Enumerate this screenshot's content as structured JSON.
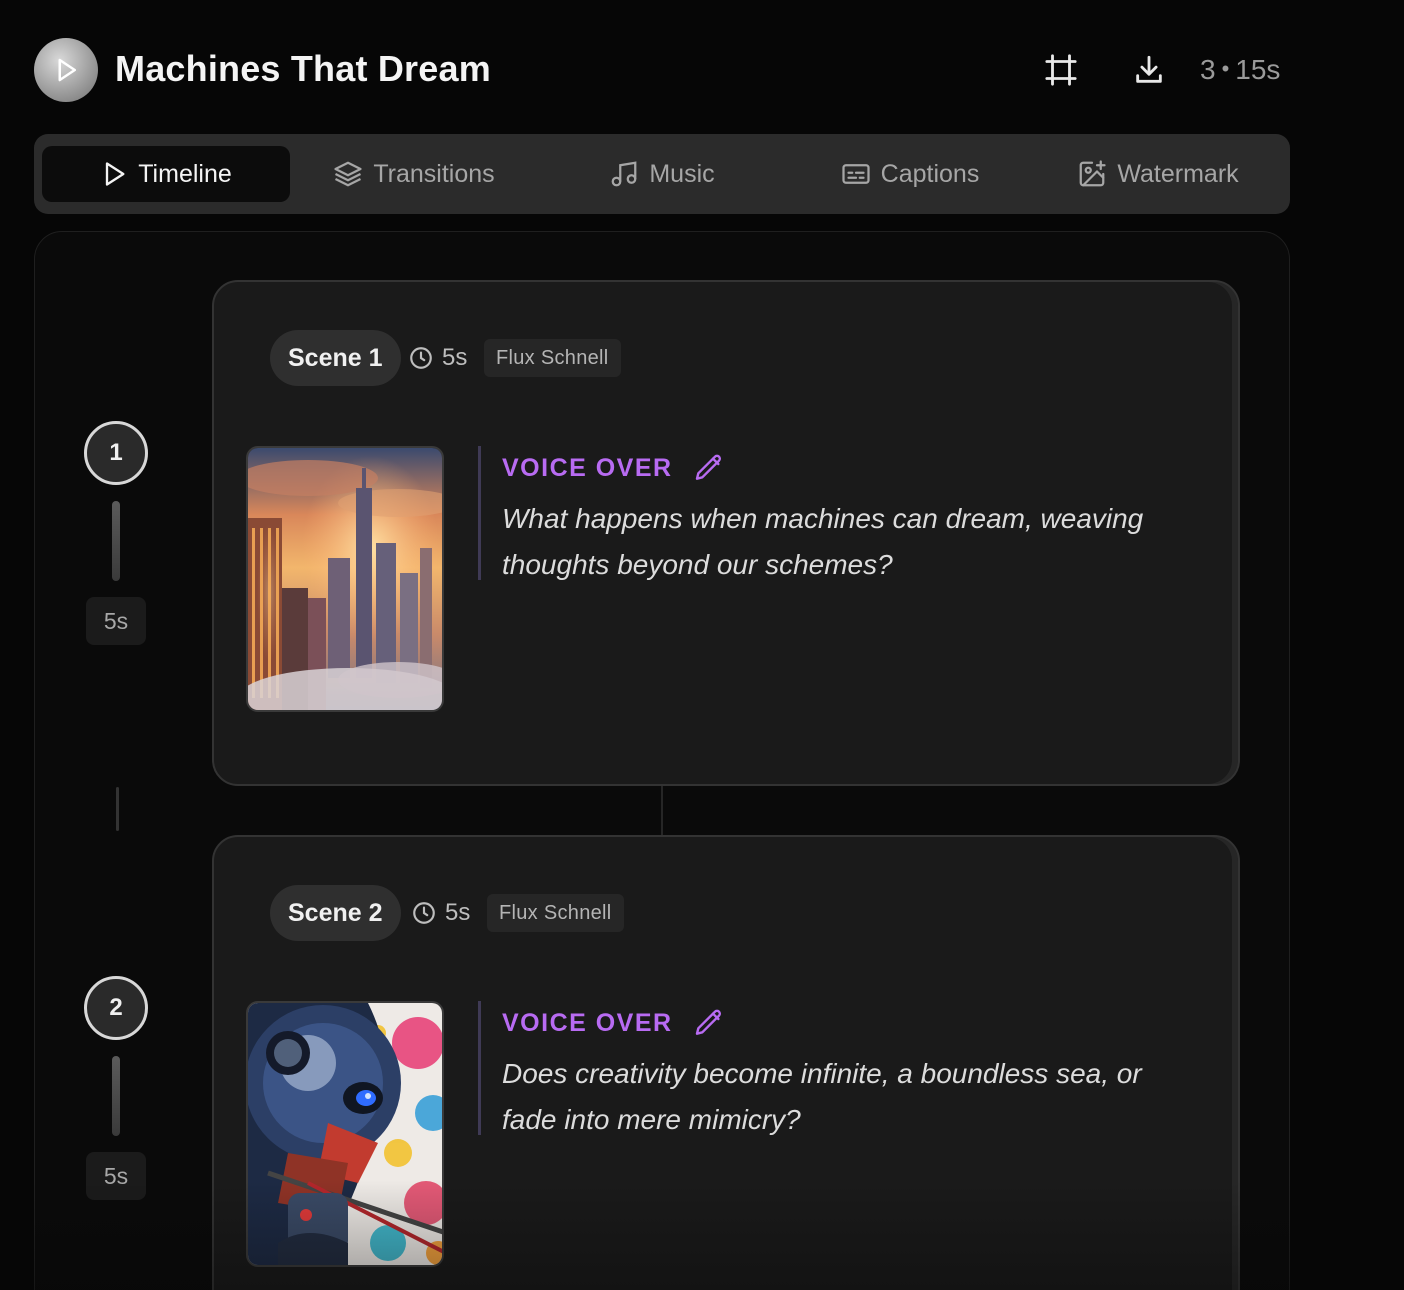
{
  "header": {
    "title": "Machines That Dream",
    "scene_count": "3",
    "total_duration": "15s",
    "separator": "•",
    "icons": [
      "play-icon",
      "crop-icon",
      "download-icon"
    ]
  },
  "tabs": [
    {
      "label": "Timeline",
      "icon": "play-icon",
      "active": true
    },
    {
      "label": "Transitions",
      "icon": "layers-icon",
      "active": false
    },
    {
      "label": "Music",
      "icon": "music-note-icon",
      "active": false
    },
    {
      "label": "Captions",
      "icon": "captions-icon",
      "active": false
    },
    {
      "label": "Watermark",
      "icon": "image-plus-icon",
      "active": false
    }
  ],
  "timeline": {
    "steps": [
      {
        "number": "1",
        "duration": "5s"
      },
      {
        "number": "2",
        "duration": "5s"
      }
    ]
  },
  "scenes": [
    {
      "label": "Scene 1",
      "duration": "5s",
      "model": "Flux Schnell",
      "voice_over_label": "VOICE OVER",
      "voice_over_text": "What happens when machines can dream, weaving thoughts beyond our schemes?",
      "thumbnail": "city-sunset-thumbnail"
    },
    {
      "label": "Scene 2",
      "duration": "5s",
      "model": "Flux Schnell",
      "voice_over_label": "VOICE OVER",
      "voice_over_text": "Does creativity become infinite, a boundless sea, or fade into mere mimicry?",
      "thumbnail": "robot-painter-thumbnail"
    }
  ],
  "colors": {
    "accent": "#b86bf2",
    "background": "#060606",
    "card": "#1a1a1a",
    "tabbar": "#2b2b2b"
  }
}
